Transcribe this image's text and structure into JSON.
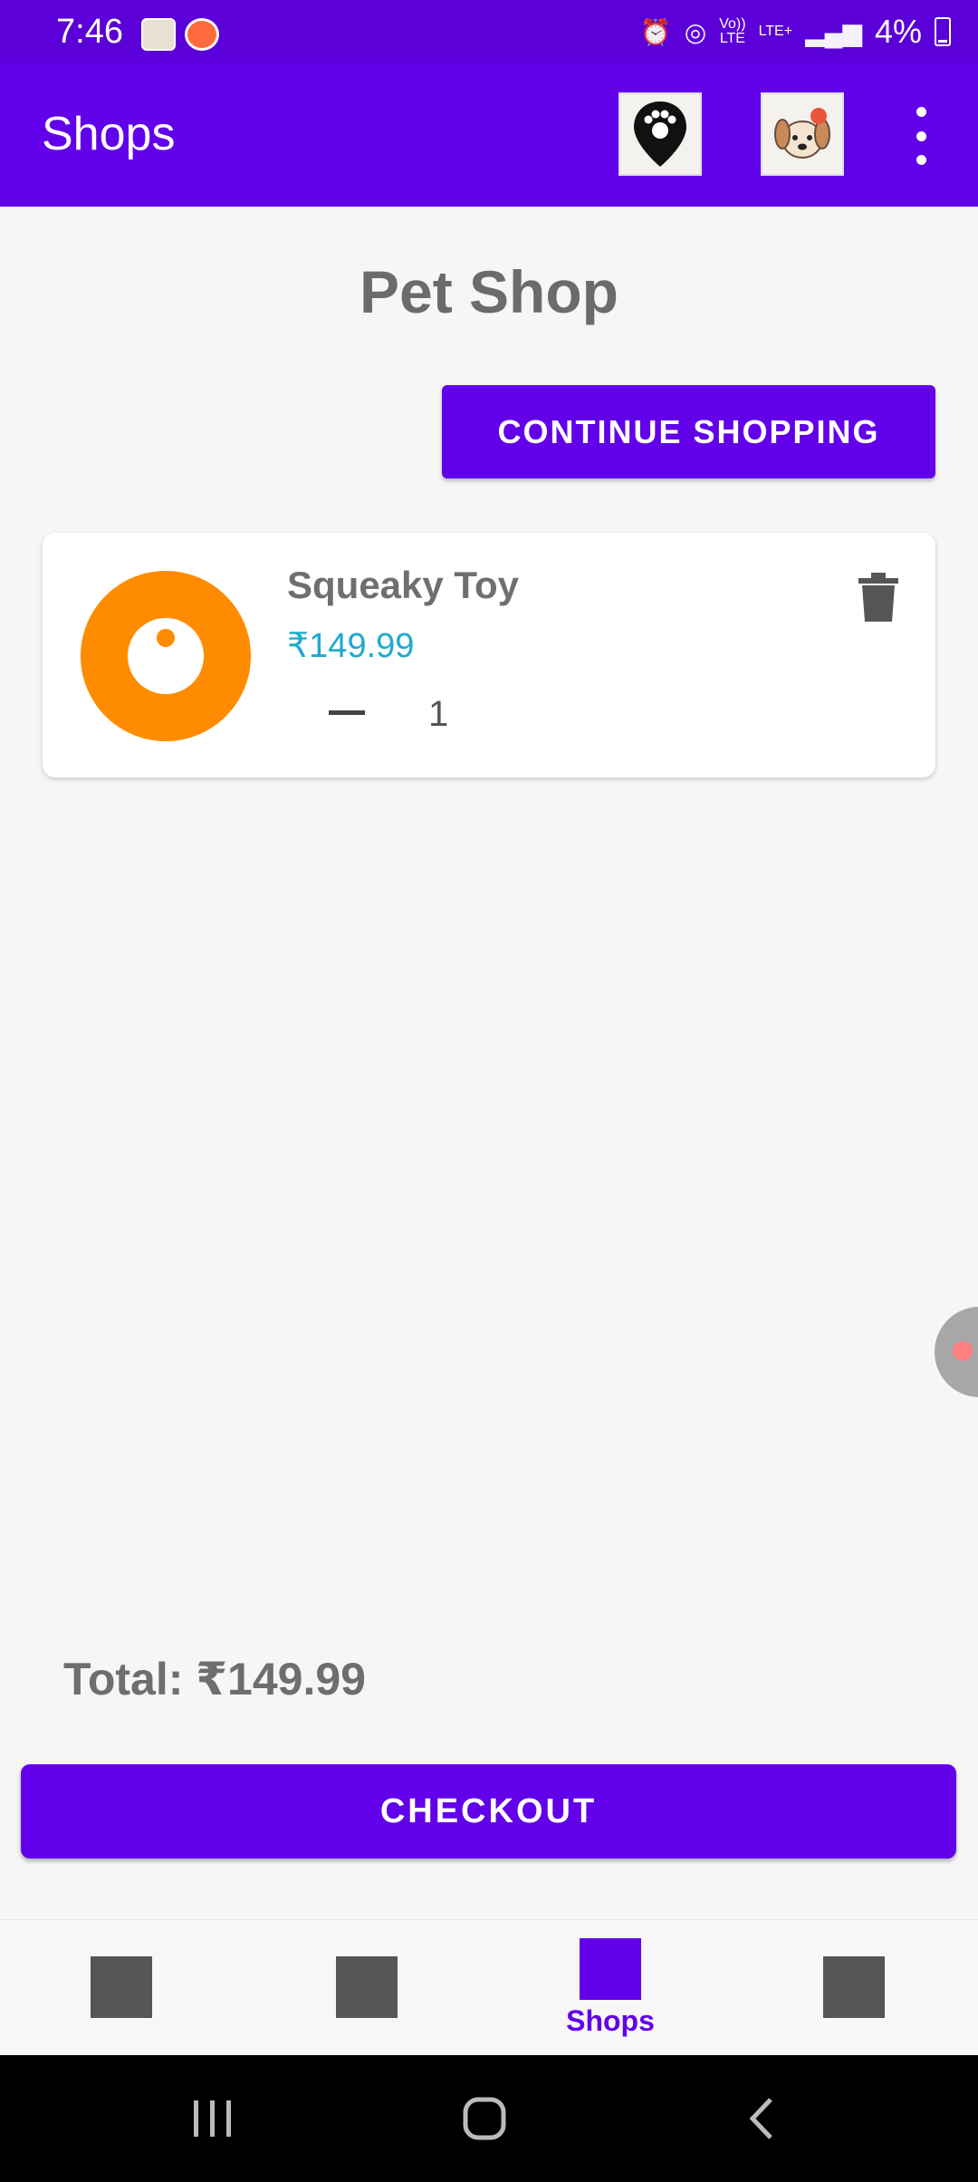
{
  "status_bar": {
    "time": "7:46",
    "network_line1": "Vo))",
    "network_line2": "LTE",
    "lte_label": "LTE+",
    "battery": "4%"
  },
  "app_bar": {
    "title": "Shops",
    "map_icon": "paw-location-pin-icon",
    "profile_icon": "dog-avatar-icon",
    "menu_icon": "more-vert-icon"
  },
  "page": {
    "title": "Pet Shop",
    "continue_label": "CONTINUE SHOPPING"
  },
  "cart": {
    "items": [
      {
        "name": "Squeaky Toy",
        "price": "₹149.99",
        "quantity": "1",
        "image_icon": "orange-ring-toy-icon"
      }
    ],
    "total": "Total: ₹149.99",
    "checkout_label": "CHECKOUT"
  },
  "bottom_nav": {
    "items": [
      {
        "label": "",
        "active": false
      },
      {
        "label": "",
        "active": false
      },
      {
        "label": "Shops",
        "active": true
      },
      {
        "label": "",
        "active": false
      }
    ]
  },
  "colors": {
    "primary": "#6200ea",
    "status_bar": "#5b00d8",
    "price": "#1eaacf",
    "background": "#f6f6f6",
    "toy_orange": "#ff8c00"
  }
}
